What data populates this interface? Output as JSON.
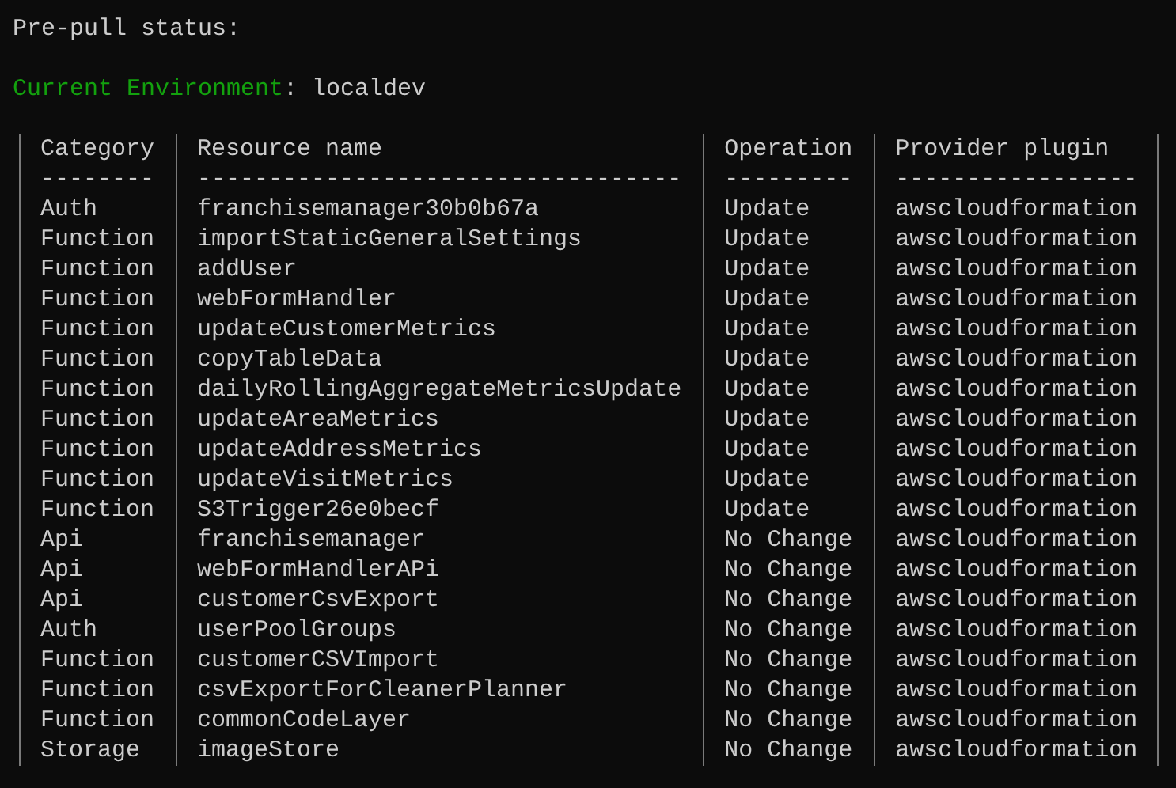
{
  "status_heading": "Pre-pull status:",
  "environment": {
    "label": "Current Environment",
    "delimiter": ":",
    "value": "localdev"
  },
  "table": {
    "columns": [
      {
        "label": "Category",
        "rule": "--------"
      },
      {
        "label": "Resource name",
        "rule": "----------------------------------"
      },
      {
        "label": "Operation",
        "rule": "---------"
      },
      {
        "label": "Provider plugin",
        "rule": "-----------------"
      }
    ],
    "rows": [
      [
        "Auth",
        "franchisemanager30b0b67a",
        "Update",
        "awscloudformation"
      ],
      [
        "Function",
        "importStaticGeneralSettings",
        "Update",
        "awscloudformation"
      ],
      [
        "Function",
        "addUser",
        "Update",
        "awscloudformation"
      ],
      [
        "Function",
        "webFormHandler",
        "Update",
        "awscloudformation"
      ],
      [
        "Function",
        "updateCustomerMetrics",
        "Update",
        "awscloudformation"
      ],
      [
        "Function",
        "copyTableData",
        "Update",
        "awscloudformation"
      ],
      [
        "Function",
        "dailyRollingAggregateMetricsUpdate",
        "Update",
        "awscloudformation"
      ],
      [
        "Function",
        "updateAreaMetrics",
        "Update",
        "awscloudformation"
      ],
      [
        "Function",
        "updateAddressMetrics",
        "Update",
        "awscloudformation"
      ],
      [
        "Function",
        "updateVisitMetrics",
        "Update",
        "awscloudformation"
      ],
      [
        "Function",
        "S3Trigger26e0becf",
        "Update",
        "awscloudformation"
      ],
      [
        "Api",
        "franchisemanager",
        "No Change",
        "awscloudformation"
      ],
      [
        "Api",
        "webFormHandlerAPi",
        "No Change",
        "awscloudformation"
      ],
      [
        "Api",
        "customerCsvExport",
        "No Change",
        "awscloudformation"
      ],
      [
        "Auth",
        "userPoolGroups",
        "No Change",
        "awscloudformation"
      ],
      [
        "Function",
        "customerCSVImport",
        "No Change",
        "awscloudformation"
      ],
      [
        "Function",
        "csvExportForCleanerPlanner",
        "No Change",
        "awscloudformation"
      ],
      [
        "Function",
        "commonCodeLayer",
        "No Change",
        "awscloudformation"
      ],
      [
        "Storage",
        "imageStore",
        "No Change",
        "awscloudformation"
      ]
    ]
  }
}
